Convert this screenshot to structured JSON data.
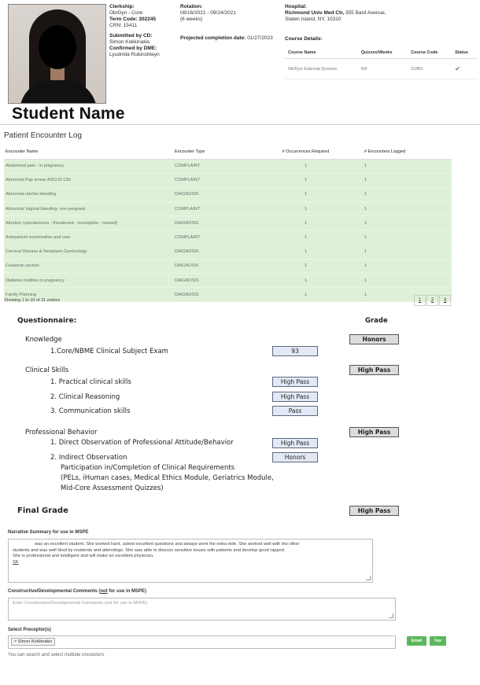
{
  "student": {
    "name": "Student Name"
  },
  "clerkship": {
    "label": "Clerkship:",
    "name": "Ob/Gyn - Core",
    "term_code": "Term Code: 202245",
    "crn": "CRN: 15411",
    "submitted_label": "Submitted by CD:",
    "submitted_by": "Simon Kokkinakis",
    "confirmed_label": "Confirmed by DME:",
    "confirmed_by": "Lyudmila Rubinshteyn"
  },
  "rotation": {
    "label": "Rotation:",
    "dates": "08/16/2021 - 09/24/2021",
    "weeks": "(6 weeks)",
    "projected_label": "Projected completion date:",
    "projected_date": "01/27/2023"
  },
  "hospital": {
    "label": "Hospital:",
    "name": "Richmond Univ Med Ctr,",
    "address1": " 355 Bard Avenue,",
    "address2": "Staten Island, NY, 10310"
  },
  "course_details": {
    "label": "Course Details:",
    "headers": [
      "Course Name",
      "Quizzes/Weeks",
      "Course Code",
      "Status"
    ],
    "rows": [
      {
        "name": "Ob/Gyn External Quizzes",
        "quizzes": "6/6",
        "code": "ZOBG",
        "status": "✔"
      }
    ]
  },
  "encounter_log": {
    "title": "Patient Encounter Log",
    "headers": [
      "Encounter Name",
      "Encounter Type",
      "# Occurrences Required",
      "# Encounters Logged"
    ],
    "rows": [
      {
        "name": "Abdominal pain - in pregnancy",
        "type": "COMPLAINT",
        "required": "1",
        "logged": "1"
      },
      {
        "name": "Abnormal Pap smear ASCUS CIN",
        "type": "COMPLAINT",
        "required": "1",
        "logged": "1"
      },
      {
        "name": "Abnormal uterine bleeding",
        "type": "DIAGNOSIS",
        "required": "1",
        "logged": "1"
      },
      {
        "name": "Abnormal Vaginal bleeding- non-pregnant",
        "type": "COMPLAINT",
        "required": "1",
        "logged": "1"
      },
      {
        "name": "Abortion (spontaneous - threatened - incomplete - missed)",
        "type": "DIAGNOSIS",
        "required": "1",
        "logged": "2"
      },
      {
        "name": "Antepartum examination and care",
        "type": "COMPLAINT",
        "required": "1",
        "logged": "1"
      },
      {
        "name": "Cervical Disease & Neoplasm Gynecology",
        "type": "DIAGNOSIS",
        "required": "1",
        "logged": "1"
      },
      {
        "name": "Cesarean section",
        "type": "DIAGNOSIS",
        "required": "1",
        "logged": "1"
      },
      {
        "name": "Diabetes mellitus in pregnancy",
        "type": "DIAGNOSIS",
        "required": "1",
        "logged": "1"
      },
      {
        "name": "Family Planning",
        "type": "DIAGNOSIS",
        "required": "1",
        "logged": "1"
      }
    ],
    "showing": "Showing 1 to 10 of 21 entries",
    "pages": [
      "1",
      "2",
      "3"
    ]
  },
  "questionnaire": {
    "title": "Questionnaire:",
    "grade_header": "Grade",
    "knowledge": {
      "label": "Knowledge",
      "grade": "Honors",
      "items": [
        {
          "label": "1.Core/NBME Clinical Subject Exam",
          "value": "93"
        }
      ]
    },
    "clinical": {
      "label": "Clinical Skills",
      "grade": "High Pass",
      "items": [
        {
          "label": "1.   Practical clinical skills",
          "value": "High Pass"
        },
        {
          "label": "2.   Clinical Reasoning",
          "value": "High Pass"
        },
        {
          "label": "3.   Communication skills",
          "value": "Pass"
        }
      ]
    },
    "professional": {
      "label": "Professional Behavior",
      "grade": "High Pass",
      "items": [
        {
          "label": "1.   Direct Observation of Professional Attitude/Behavior",
          "value": "High Pass"
        },
        {
          "label": "2.   Indirect Observation",
          "value": "Honors"
        }
      ],
      "note1": "Participation in/Completion of Clinical Requirements",
      "note2": "(PELs, iHuman cases, Medical Ethics Module, Geriatrics Module,",
      "note3": "Mid-Core Assessment Quizzes)"
    },
    "final_label": "Final Grade",
    "final_grade": "High Pass"
  },
  "narrative": {
    "label": "Narrative Summary for use in MSPE",
    "line1": "was an excellent student. She worked hard, asked excellent questions and always went the extra mile. She worked well with the other",
    "line2": "students and was well liked by residents and attendings. She was able to discuss sensitive issues with patients and develop good rapport.",
    "line3": "She is professional and intelligent and will make an excellent physician.",
    "line4": "SK"
  },
  "constructive": {
    "label_pre": "Constructive/Developmental Comments (",
    "label_not": "not",
    "label_post": " for use in MSPE)",
    "placeholder": "Enter Constructive/Developmental Comments (not for use in MSPE)"
  },
  "preceptor": {
    "label": "Select Preceptor(s)",
    "selected": "× Simon Kokkinakis",
    "hint": "You can search and select multiple preceptors",
    "email_btn": "Email",
    "fax_btn": "Fax"
  }
}
